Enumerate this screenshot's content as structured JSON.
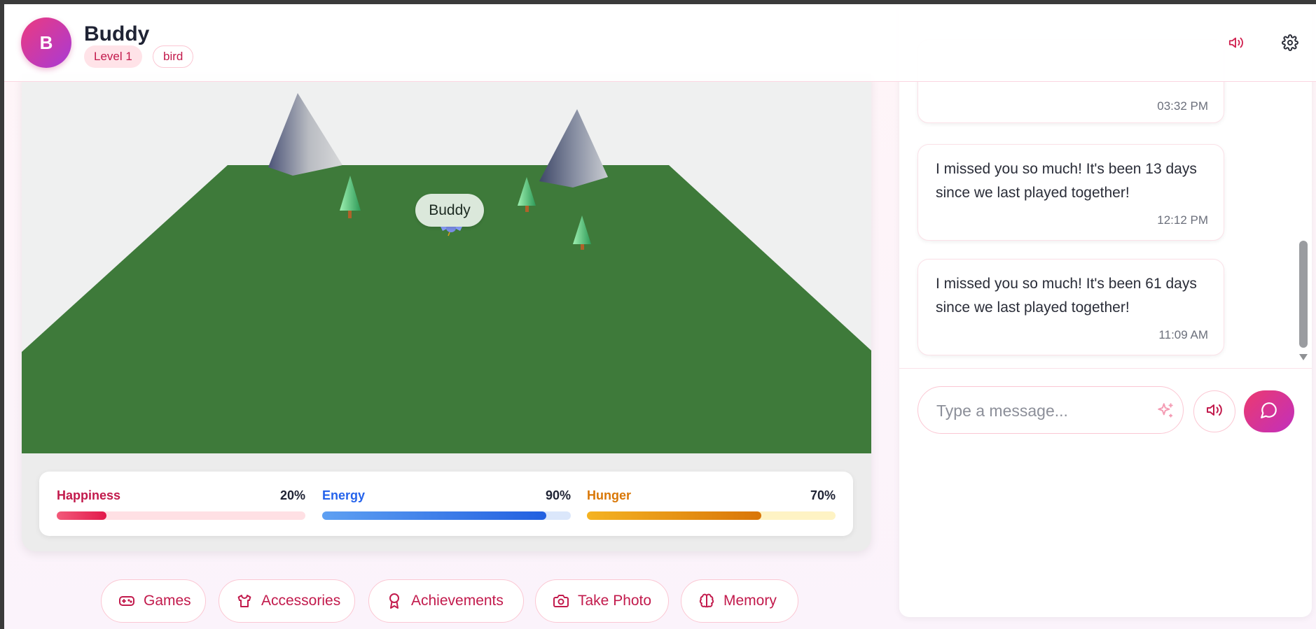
{
  "header": {
    "avatar_letter": "B",
    "pet_name": "Buddy",
    "level": "Level 1",
    "species": "bird",
    "sound_icon": "volume-icon",
    "settings_icon": "gear-icon"
  },
  "scene": {
    "pet_label": "Buddy",
    "colors": {
      "ground": "#3e7a3a",
      "sky": "#eff0f0",
      "accent": "#c21a4c"
    }
  },
  "stats": {
    "happiness": {
      "label": "Happiness",
      "value_text": "20%",
      "value": 20
    },
    "energy": {
      "label": "Energy",
      "value_text": "90%",
      "value": 90
    },
    "hunger": {
      "label": "Hunger",
      "value_text": "70%",
      "value": 70
    }
  },
  "actions": [
    {
      "label": "Games",
      "icon": "gamepad-icon"
    },
    {
      "label": "Accessories",
      "icon": "shirt-icon"
    },
    {
      "label": "Achievements",
      "icon": "award-icon"
    },
    {
      "label": "Take Photo",
      "icon": "camera-icon"
    },
    {
      "label": "Memory",
      "icon": "brain-icon"
    }
  ],
  "chat": {
    "messages": [
      {
        "text": "",
        "time": "03:32 PM"
      },
      {
        "text": "I missed you so much! It's been 13 days since we last played together!",
        "time": "12:12 PM"
      },
      {
        "text": "I missed you so much! It's been 61 days since we last played together!",
        "time": "11:09 AM"
      }
    ],
    "input_placeholder": "Type a message...",
    "input_value": ""
  }
}
